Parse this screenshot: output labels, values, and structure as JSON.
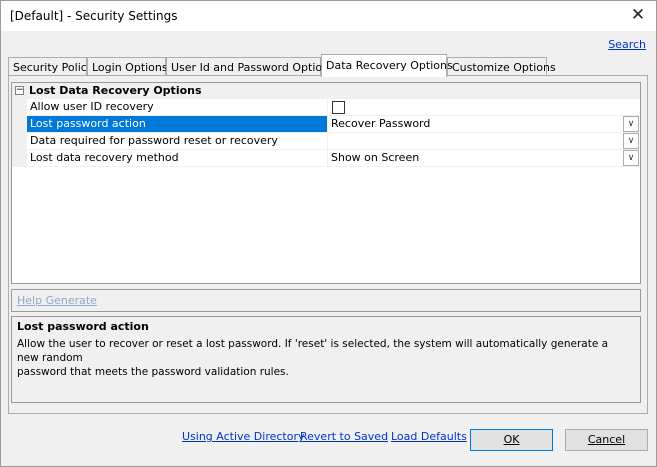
{
  "window": {
    "title": "[Default] - Security Settings",
    "close_symbol": "✕"
  },
  "search_link": "Search",
  "tabs": [
    {
      "label": "Security Policy",
      "active": false
    },
    {
      "label": "Login Options",
      "active": false
    },
    {
      "label": "User Id and Password Options",
      "active": false
    },
    {
      "label": "Data Recovery Options",
      "active": true
    },
    {
      "label": "Customize Options",
      "active": false
    }
  ],
  "grid": {
    "category": {
      "label": "Lost Data Recovery Options",
      "expander": "−"
    },
    "properties": [
      {
        "name": "Allow user ID recovery",
        "value": "",
        "editor": "checkbox",
        "checked": false,
        "selected": false
      },
      {
        "name": "Lost password action",
        "value": "Recover Password",
        "editor": "dropdown",
        "selected": true
      },
      {
        "name": "Data required for password reset or recovery",
        "value": "",
        "editor": "dropdown",
        "selected": false
      },
      {
        "name": "Lost data recovery method",
        "value": "Show on Screen",
        "editor": "dropdown",
        "selected": false
      }
    ],
    "dropdown_icon": "chevron-down-icon",
    "selection_color": "#0078d7"
  },
  "command_pane": {
    "link": "Help Generate"
  },
  "help_pane": {
    "title": "Lost password action",
    "line1": "Allow the user to recover or reset a lost password.  If 'reset' is selected, the system will automatically generate a new random",
    "line2": "password that meets the password validation rules."
  },
  "footer": {
    "links": [
      "Using Active Directory",
      "Revert to Saved",
      "Load Defaults"
    ],
    "ok_label": "OK",
    "cancel_label": "Cancel"
  }
}
